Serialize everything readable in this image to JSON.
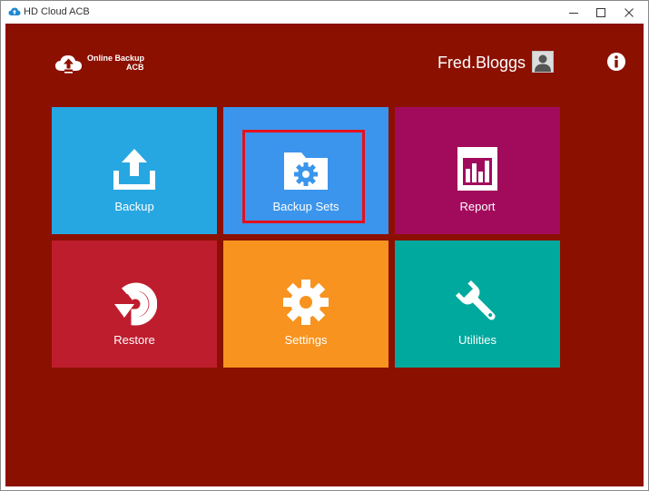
{
  "window": {
    "title": "HD Cloud ACB",
    "controls": [
      "minimize-icon",
      "maximize-icon",
      "close-icon"
    ]
  },
  "header": {
    "logo_line1": "Online Backup",
    "logo_line2": "ACB",
    "username": "Fred.Bloggs",
    "avatar_icon": "user-avatar-icon",
    "info_icon": "info-icon"
  },
  "tiles": [
    {
      "label": "Backup",
      "icon": "upload-icon",
      "color": "#27a7e1"
    },
    {
      "label": "Backup Sets",
      "icon": "folder-gear-icon",
      "color": "#3b95ec",
      "highlighted": true
    },
    {
      "label": "Report",
      "icon": "report-chart-icon",
      "color": "#a20a5c"
    },
    {
      "label": "Restore",
      "icon": "restore-arrow-icon",
      "color": "#be1d2d"
    },
    {
      "label": "Settings",
      "icon": "gear-icon",
      "color": "#f7931e"
    },
    {
      "label": "Utilities",
      "icon": "wrench-icon",
      "color": "#00a99d"
    }
  ],
  "colors": {
    "background": "#8c1000",
    "highlight_border": "#e4101c"
  }
}
